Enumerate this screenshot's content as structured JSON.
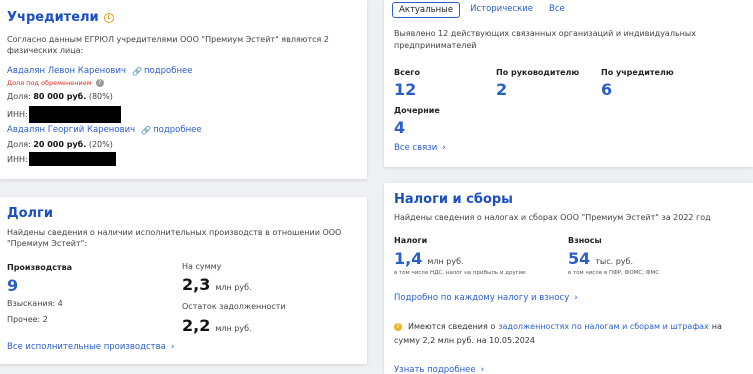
{
  "founders": {
    "title": "Учредители",
    "intro": "Согласно данным ЕГРЮЛ учредителями ООО \"Премиум Эстейт\" являются 2 физических лица:",
    "persons": [
      {
        "name": "Авдалян Левон Каренович",
        "more": "подробнее",
        "encumbrance": "Доля под обременением",
        "share_label": "Доля:",
        "share_value": "80 000 руб.",
        "share_percent": "(80%)",
        "inn_label": "ИНН:"
      },
      {
        "name": "Авдалян Георгий Каренович",
        "more": "подробнее",
        "share_label": "Доля:",
        "share_value": "20 000 руб.",
        "share_percent": "(20%)",
        "inn_label": "ИНН:"
      }
    ]
  },
  "connections": {
    "tabs": [
      "Актуальные",
      "Исторические",
      "Все"
    ],
    "intro": "Выявлено 12 действующих связанных организаций и индивидуальных предпринимателей",
    "stats": [
      {
        "label": "Всего",
        "value": "12"
      },
      {
        "label": "По руководителю",
        "value": "2"
      },
      {
        "label": "По учредителю",
        "value": "6"
      },
      {
        "label": "Дочерние",
        "value": "4"
      }
    ],
    "all_link": "Все связи"
  },
  "debts": {
    "title": "Долги",
    "intro": "Найдены сведения о наличии исполнительных производств в отношении ООО \"Премиум Эстейт\":",
    "proceedings_label": "Производства",
    "proceedings_value": "9",
    "recovery_text": "Взыскания: 4",
    "other_text": "Прочее: 2",
    "sum_label": "На сумму",
    "sum_value": "2,3",
    "sum_unit": "млн руб.",
    "remain_label": "Остаток задолженности",
    "remain_value": "2,2",
    "remain_unit": "млн руб.",
    "all_link": "Все исполнительные производства"
  },
  "taxes": {
    "title": "Налоги и сборы",
    "intro": "Найдены сведения о налогах и сборах ООО \"Премиум Эстейт\" за 2022 год",
    "taxes_label": "Налоги",
    "taxes_value": "1,4",
    "taxes_unit": "млн руб.",
    "taxes_note": "в том числе НДС, налог на прибыль и другие",
    "fees_label": "Взносы",
    "fees_value": "54",
    "fees_unit": "тыс. руб.",
    "fees_note": "в том числе в ПФР, ФОМС, ФМС",
    "detail_link": "Подробно по каждому налогу и взносу",
    "notice_pre": "Имеются сведения о",
    "notice_link": "задолженностях по налогам и сборам и штрафах",
    "notice_post": "на",
    "notice_line2": "сумму 2,2 млн руб. на 10.05.2024",
    "more_link": "Узнать подробнее"
  },
  "colors": {
    "accent": "#2a5ec9",
    "title": "#1a4fc2",
    "warning": "#f2b01e",
    "danger": "#d93025"
  }
}
